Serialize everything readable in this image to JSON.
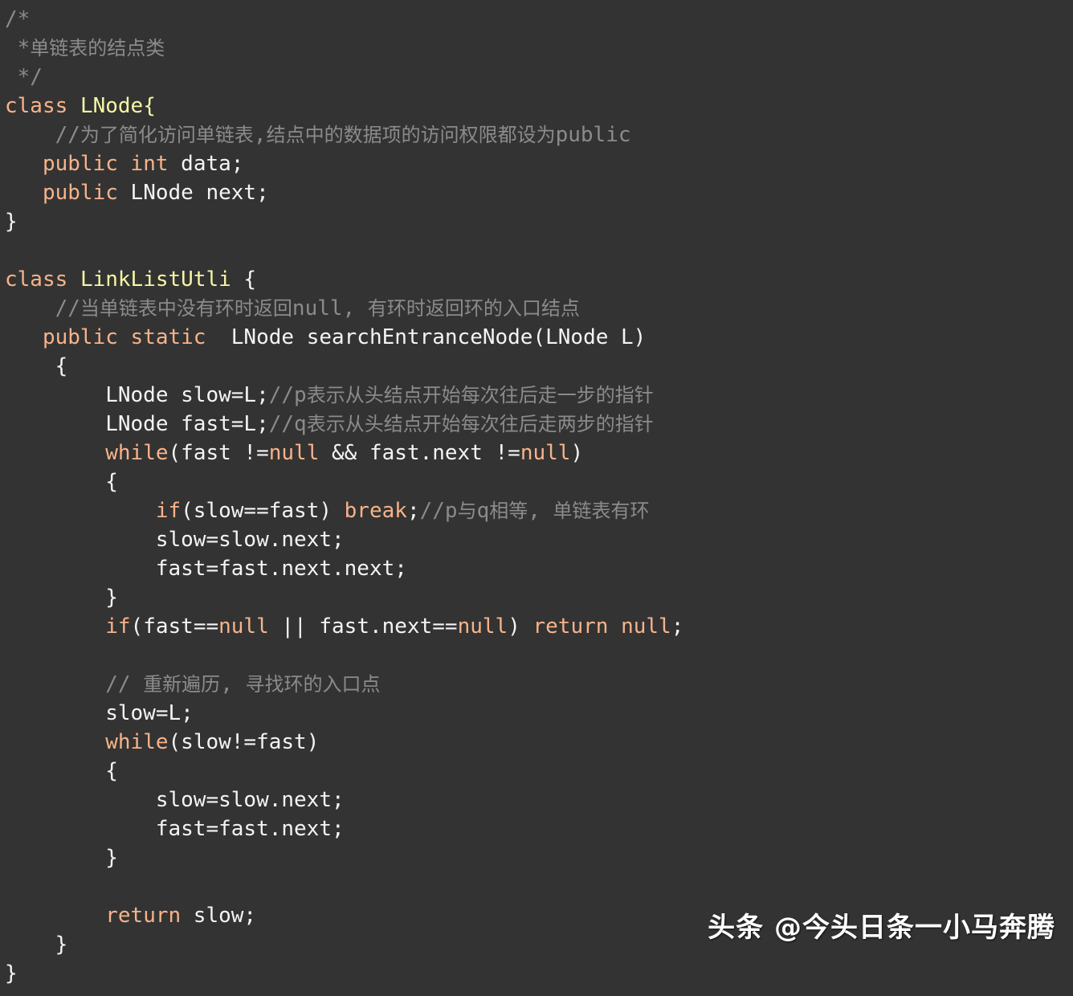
{
  "editor": {
    "background_color": "#333333",
    "default_text_color": "#f4f4f4",
    "keyword_color": "#f7b38a",
    "type_color": "#f5f5a5",
    "comment_color": "#8b8b8b",
    "language": "Java"
  },
  "code": {
    "lines": [
      {
        "indent": 0,
        "tokens": [
          {
            "t": "comment",
            "v": "/*"
          }
        ]
      },
      {
        "indent": 0,
        "tokens": [
          {
            "t": "comment",
            "v": " *单链表的结点类"
          }
        ]
      },
      {
        "indent": 0,
        "tokens": [
          {
            "t": "comment",
            "v": " */"
          }
        ]
      },
      {
        "indent": 0,
        "tokens": [
          {
            "t": "keyword",
            "v": "class"
          },
          {
            "t": "plain",
            "v": " "
          },
          {
            "t": "type",
            "v": "LNode{"
          }
        ]
      },
      {
        "indent": 0,
        "tokens": [
          {
            "t": "comment",
            "v": "    //为了简化访问单链表,结点中的数据项的访问权限都设为public"
          }
        ]
      },
      {
        "indent": 0,
        "tokens": [
          {
            "t": "plain",
            "v": "   "
          },
          {
            "t": "keyword",
            "v": "public int"
          },
          {
            "t": "plain",
            "v": " data;"
          }
        ]
      },
      {
        "indent": 0,
        "tokens": [
          {
            "t": "plain",
            "v": "   "
          },
          {
            "t": "keyword",
            "v": "public"
          },
          {
            "t": "plain",
            "v": " LNode next;"
          }
        ]
      },
      {
        "indent": 0,
        "tokens": [
          {
            "t": "plain",
            "v": "}"
          }
        ]
      },
      {
        "indent": 0,
        "tokens": []
      },
      {
        "indent": 0,
        "tokens": [
          {
            "t": "keyword",
            "v": "class"
          },
          {
            "t": "plain",
            "v": " "
          },
          {
            "t": "type",
            "v": "LinkListUtli"
          },
          {
            "t": "plain",
            "v": " {"
          }
        ]
      },
      {
        "indent": 0,
        "tokens": [
          {
            "t": "comment",
            "v": "    //当单链表中没有环时返回null, 有环时返回环的入口结点"
          }
        ]
      },
      {
        "indent": 0,
        "tokens": [
          {
            "t": "plain",
            "v": "   "
          },
          {
            "t": "keyword",
            "v": "public static"
          },
          {
            "t": "plain",
            "v": "  LNode searchEntranceNode(LNode L)"
          }
        ]
      },
      {
        "indent": 0,
        "tokens": [
          {
            "t": "plain",
            "v": "    {"
          }
        ]
      },
      {
        "indent": 0,
        "tokens": [
          {
            "t": "plain",
            "v": "        LNode slow=L;"
          },
          {
            "t": "comment",
            "v": "//p表示从头结点开始每次往后走一步的指针"
          }
        ]
      },
      {
        "indent": 0,
        "tokens": [
          {
            "t": "plain",
            "v": "        LNode fast=L;"
          },
          {
            "t": "comment",
            "v": "//q表示从头结点开始每次往后走两步的指针"
          }
        ]
      },
      {
        "indent": 0,
        "tokens": [
          {
            "t": "plain",
            "v": "        "
          },
          {
            "t": "keyword",
            "v": "while"
          },
          {
            "t": "plain",
            "v": "(fast !="
          },
          {
            "t": "keyword",
            "v": "null"
          },
          {
            "t": "plain",
            "v": " && fast.next !="
          },
          {
            "t": "keyword",
            "v": "null"
          },
          {
            "t": "plain",
            "v": ")"
          }
        ]
      },
      {
        "indent": 0,
        "tokens": [
          {
            "t": "plain",
            "v": "        {"
          }
        ]
      },
      {
        "indent": 0,
        "tokens": [
          {
            "t": "plain",
            "v": "            "
          },
          {
            "t": "keyword",
            "v": "if"
          },
          {
            "t": "plain",
            "v": "(slow==fast) "
          },
          {
            "t": "keyword",
            "v": "break"
          },
          {
            "t": "plain",
            "v": ";"
          },
          {
            "t": "comment",
            "v": "//p与q相等, 单链表有环"
          }
        ]
      },
      {
        "indent": 0,
        "tokens": [
          {
            "t": "plain",
            "v": "            slow=slow.next;"
          }
        ]
      },
      {
        "indent": 0,
        "tokens": [
          {
            "t": "plain",
            "v": "            fast=fast.next.next;"
          }
        ]
      },
      {
        "indent": 0,
        "tokens": [
          {
            "t": "plain",
            "v": "        }"
          }
        ]
      },
      {
        "indent": 0,
        "tokens": [
          {
            "t": "plain",
            "v": "        "
          },
          {
            "t": "keyword",
            "v": "if"
          },
          {
            "t": "plain",
            "v": "(fast=="
          },
          {
            "t": "keyword",
            "v": "null"
          },
          {
            "t": "plain",
            "v": " || fast.next=="
          },
          {
            "t": "keyword",
            "v": "null"
          },
          {
            "t": "plain",
            "v": ") "
          },
          {
            "t": "keyword",
            "v": "return null"
          },
          {
            "t": "plain",
            "v": ";"
          }
        ]
      },
      {
        "indent": 0,
        "tokens": []
      },
      {
        "indent": 0,
        "tokens": [
          {
            "t": "comment",
            "v": "        // 重新遍历, 寻找环的入口点"
          }
        ]
      },
      {
        "indent": 0,
        "tokens": [
          {
            "t": "plain",
            "v": "        slow=L;"
          }
        ]
      },
      {
        "indent": 0,
        "tokens": [
          {
            "t": "plain",
            "v": "        "
          },
          {
            "t": "keyword",
            "v": "while"
          },
          {
            "t": "plain",
            "v": "(slow!=fast)"
          }
        ]
      },
      {
        "indent": 0,
        "tokens": [
          {
            "t": "plain",
            "v": "        {"
          }
        ]
      },
      {
        "indent": 0,
        "tokens": [
          {
            "t": "plain",
            "v": "            slow=slow.next;"
          }
        ]
      },
      {
        "indent": 0,
        "tokens": [
          {
            "t": "plain",
            "v": "            fast=fast.next;"
          }
        ]
      },
      {
        "indent": 0,
        "tokens": [
          {
            "t": "plain",
            "v": "        }"
          }
        ]
      },
      {
        "indent": 0,
        "tokens": []
      },
      {
        "indent": 0,
        "tokens": [
          {
            "t": "plain",
            "v": "        "
          },
          {
            "t": "keyword",
            "v": "return"
          },
          {
            "t": "plain",
            "v": " slow;"
          }
        ]
      },
      {
        "indent": 0,
        "tokens": [
          {
            "t": "plain",
            "v": "    }"
          }
        ]
      },
      {
        "indent": 0,
        "tokens": [
          {
            "t": "plain",
            "v": "}"
          }
        ]
      }
    ]
  },
  "watermark": {
    "brand": "头条",
    "handle": "@今头日条一小马奔腾",
    "full_text": "头条 @今头日条一小马奔腾"
  }
}
